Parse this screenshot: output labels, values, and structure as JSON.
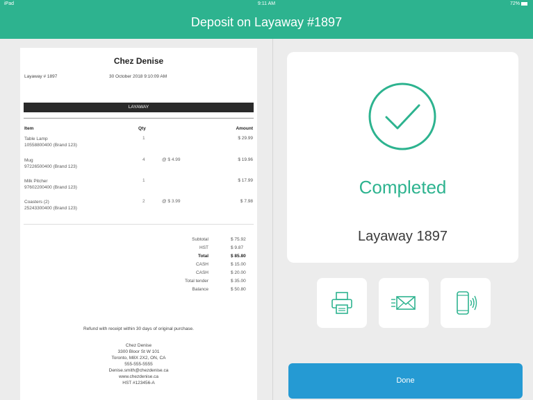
{
  "status_bar": {
    "carrier": "iPad",
    "time": "9:11 AM",
    "battery": "72%"
  },
  "header": {
    "title": "Deposit on Layaway #1897"
  },
  "receipt": {
    "store_name": "Chez Denise",
    "layaway_label": "Layaway # 1897",
    "date": "30 October 2018 9:10:09 AM",
    "band_label": "LAYAWAY",
    "columns": {
      "item": "Item",
      "qty": "Qty",
      "amount": "Amount"
    },
    "items": [
      {
        "name": "Table Lamp",
        "sku": "10558800400 (Brand 123)",
        "qty": "1",
        "unit": "",
        "amount": "$ 29.99"
      },
      {
        "name": "Mug",
        "sku": "97226500400 (Brand 123)",
        "qty": "4",
        "unit": "@ $ 4.99",
        "amount": "$ 19.96"
      },
      {
        "name": "Milk Pitcher",
        "sku": "97602200400 (Brand 123)",
        "qty": "1",
        "unit": "",
        "amount": "$ 17.99"
      },
      {
        "name": "Coasters (2)",
        "sku": "25243300400 (Brand 123)",
        "qty": "2",
        "unit": "@ $ 3.99",
        "amount": "$ 7.98"
      }
    ],
    "totals": [
      {
        "label": "Subtotal",
        "value": "$ 75.92"
      },
      {
        "label": "HST",
        "value": "$ 9.87"
      },
      {
        "label": "Total",
        "value": "$ 85.80"
      },
      {
        "label": "CASH",
        "value": "$ 15.00"
      },
      {
        "label": "CASH",
        "value": "$ 20.00"
      },
      {
        "label": "Total tender",
        "value": "$ 35.00"
      },
      {
        "label": "Balance",
        "value": "$ 50.80"
      }
    ],
    "refund_note": "Refund with receipt within 30 days of original purchase.",
    "address": {
      "name": "Chez Denise",
      "street": "3300 Bloor St W 101",
      "city": "Toronto, M8X 2X2, ON, CA",
      "phone": "555-555-5555",
      "email": "Denise.smith@chezdenise.ca",
      "web": "www.chezdenise.ca",
      "hst": "HST #123456-A"
    }
  },
  "result": {
    "status_label": "Completed",
    "layaway_label": "Layaway 1897",
    "accent": "#2db38f"
  },
  "actions": {
    "print_icon": "printer-icon",
    "email_icon": "envelope-icon",
    "nfc_icon": "phone-tap-icon",
    "done_label": "Done",
    "done_color": "#259ad3"
  }
}
